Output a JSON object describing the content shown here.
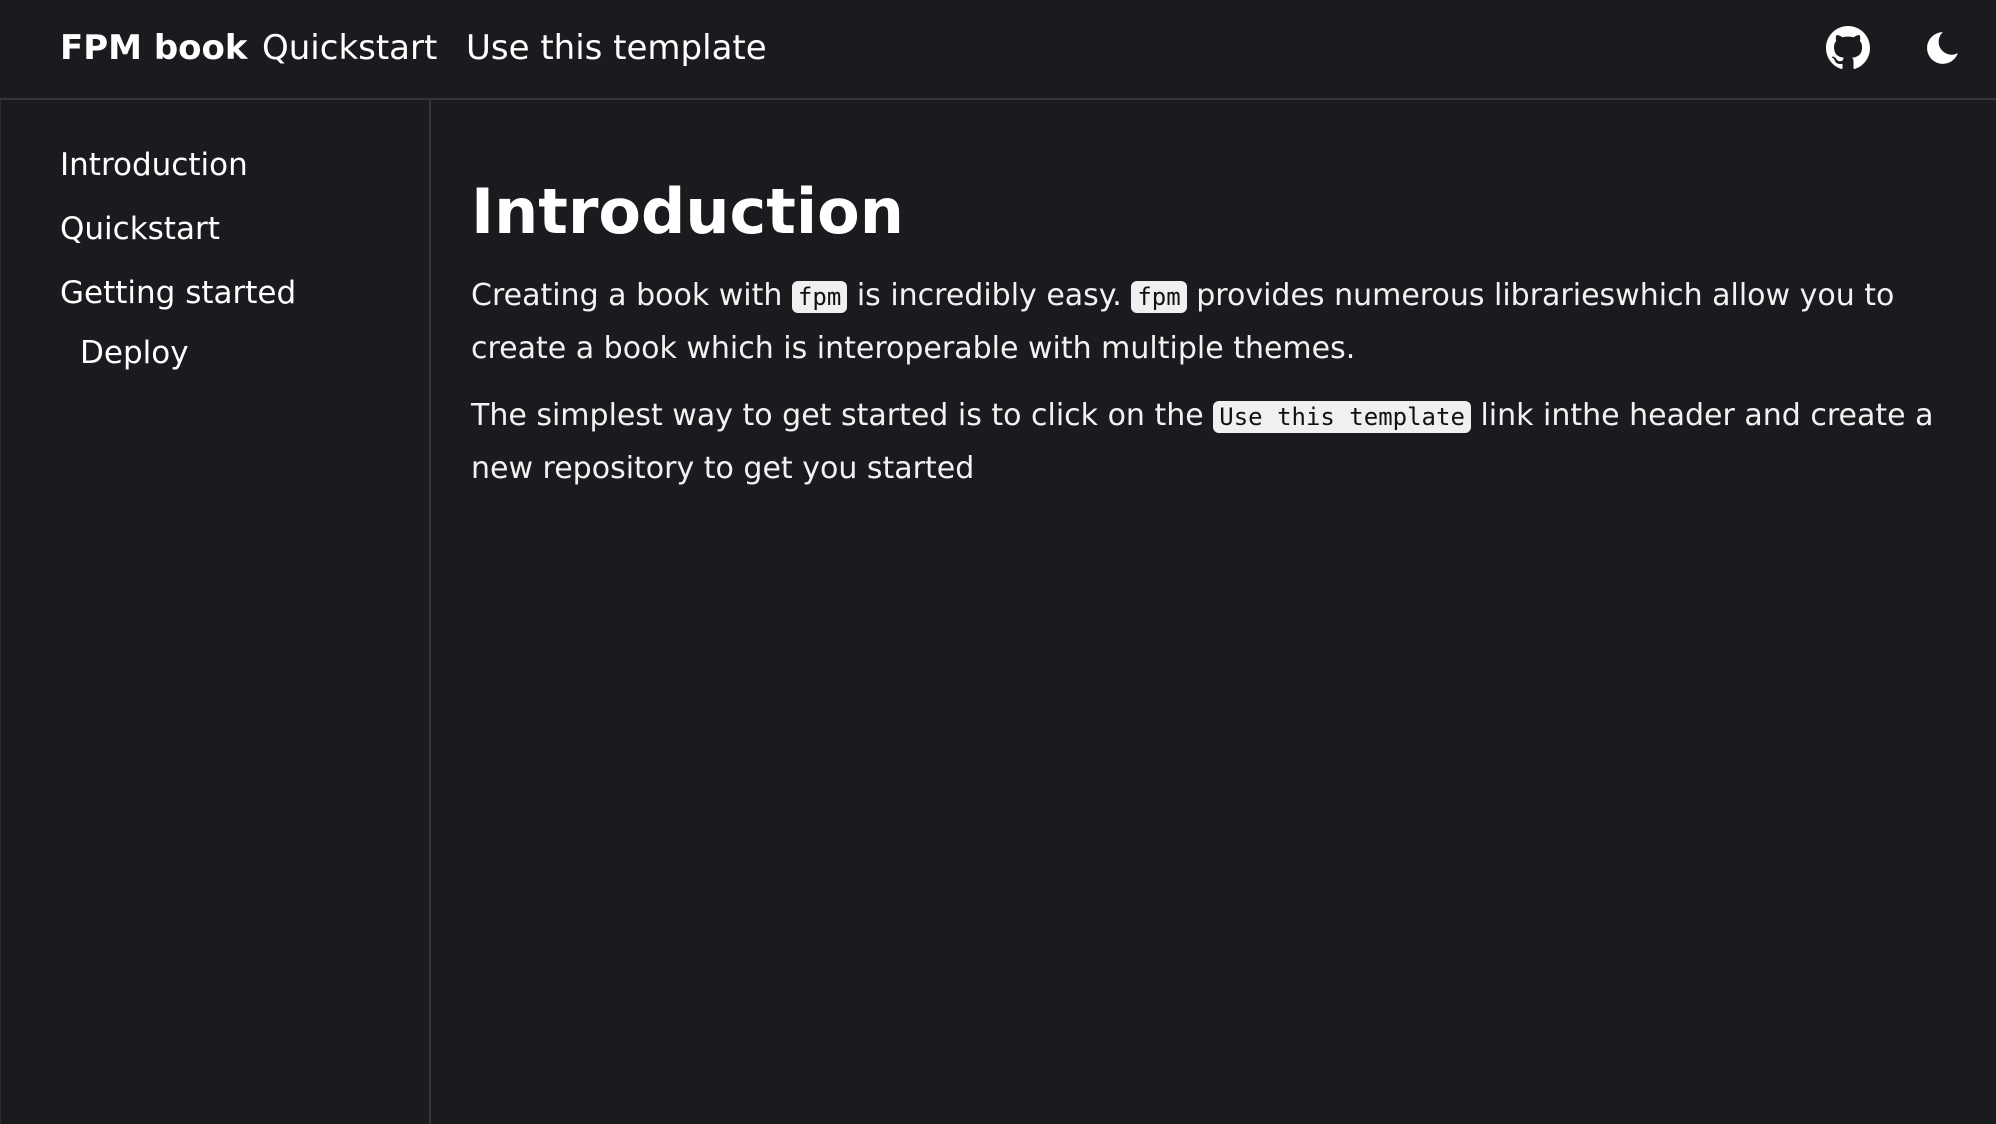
{
  "header": {
    "brand": "FPM book",
    "nav": {
      "quickstart": "Quickstart",
      "use_template": "Use this template"
    },
    "icons": {
      "github": "github-icon",
      "theme": "moon-icon"
    }
  },
  "sidebar": {
    "items": [
      {
        "label": "Introduction"
      },
      {
        "label": "Quickstart"
      },
      {
        "label": "Getting started"
      },
      {
        "label": "Deploy"
      }
    ]
  },
  "main": {
    "title": "Introduction",
    "para1": {
      "t1": "Creating a book with ",
      "code1": "fpm",
      "t2": " is incredibly easy. ",
      "code2": "fpm",
      "t3": " provides numerous librarieswhich allow you to create a book which is interoperable with multiple themes."
    },
    "para2": {
      "t1": "The simplest way to get started is to click on the ",
      "code1": "Use this template",
      "t2": " link inthe header and create a new repository to get you started"
    }
  },
  "colors": {
    "background": "#1a1b1e",
    "text": "#ffffff",
    "border": "#34363b",
    "code_bg": "#f0f0f0"
  }
}
